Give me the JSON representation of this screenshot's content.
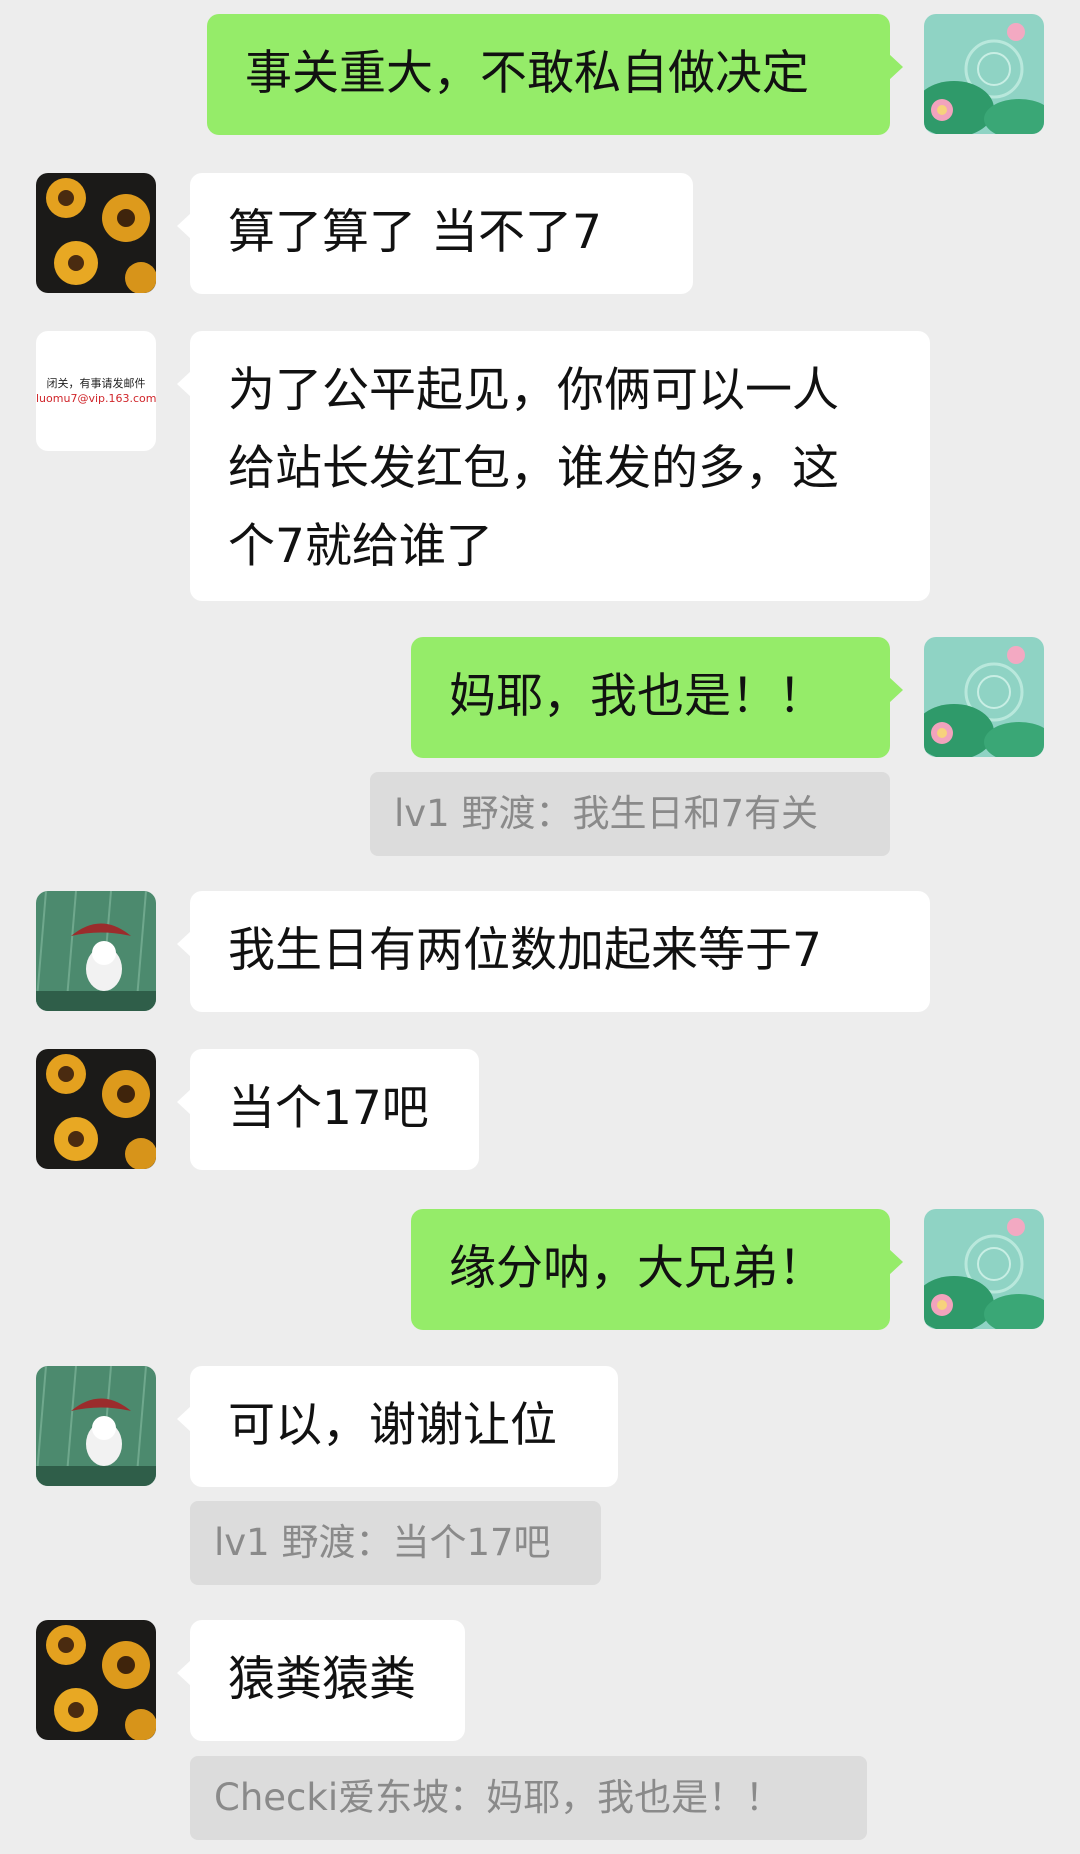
{
  "messages": [
    {
      "id": "m1",
      "side": "outgoing",
      "avatar": "lotus-avatar-icon",
      "text": "事关重大，不敢私自做决定"
    },
    {
      "id": "m2",
      "side": "incoming",
      "avatar": "sunflower-avatar-icon",
      "text": "算了算了   当不了7"
    },
    {
      "id": "m3",
      "side": "incoming",
      "avatar": "text-avatar",
      "lines": [
        "为了公平起见，你俩可以一人",
        "给站长发红包，谁发的多，这",
        "个7就给谁了"
      ]
    },
    {
      "id": "m4",
      "side": "outgoing",
      "avatar": "lotus-avatar-icon",
      "text": "妈耶，我也是！！",
      "quote": "lv1  野渡：我生日和7有关"
    },
    {
      "id": "m5",
      "side": "incoming",
      "avatar": "rain-creature-avatar-icon",
      "text": "我生日有两位数加起来等于7"
    },
    {
      "id": "m6",
      "side": "incoming",
      "avatar": "sunflower-avatar-icon",
      "text": "当个17吧"
    },
    {
      "id": "m7",
      "side": "outgoing",
      "avatar": "lotus-avatar-icon",
      "text": "缘分呐，大兄弟！"
    },
    {
      "id": "m8",
      "side": "incoming",
      "avatar": "rain-creature-avatar-icon",
      "text": "可以，谢谢让位",
      "quote": "lv1  野渡：当个17吧"
    },
    {
      "id": "m9",
      "side": "incoming",
      "avatar": "sunflower-avatar-icon",
      "text": "猿粪猿粪",
      "quote": "Checki爱东坡：妈耶，我也是！！"
    }
  ],
  "text_avatar": {
    "line1": "闭关，有事请发邮件",
    "line2": "luomu7@vip.163.com"
  },
  "colors": {
    "background": "#ededed",
    "outgoing_bubble": "#95ec69",
    "incoming_bubble": "#ffffff",
    "quote_background": "#dcdcdc",
    "quote_text": "#8a8a8a",
    "avatar_email_red": "#d0262b"
  }
}
